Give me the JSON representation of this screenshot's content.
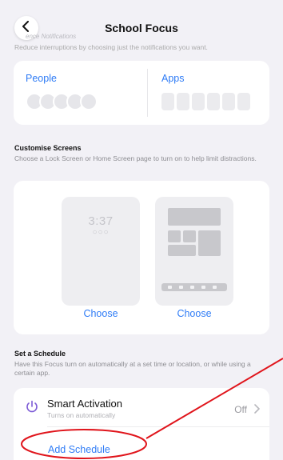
{
  "header": {
    "title": "School Focus",
    "faded_heading": "ence Notifications",
    "description": "Reduce interruptions by choosing just the notifications you want."
  },
  "allow": {
    "people_label": "People",
    "apps_label": "Apps"
  },
  "customise": {
    "heading": "Customise Screens",
    "description": "Choose a Lock Screen or Home Screen page to turn on to help limit distractions.",
    "lock_preview": {
      "time": "3:37",
      "dots": "○○○"
    },
    "lock_choose": "Choose",
    "home_choose": "Choose"
  },
  "schedule": {
    "heading": "Set a Schedule",
    "description": "Have this Focus turn on automatically at a set time or location, or while using a certain app.",
    "smart_activation": {
      "title": "Smart Activation",
      "subtitle": "Turns on automatically",
      "value": "Off"
    },
    "add_label": "Add Schedule"
  },
  "colors": {
    "accent": "#2f7cf6",
    "background": "#f2f1f6",
    "annotation": "#e0141b"
  },
  "icons": [
    "chevron-left-icon",
    "power-icon",
    "chevron-right-icon"
  ]
}
